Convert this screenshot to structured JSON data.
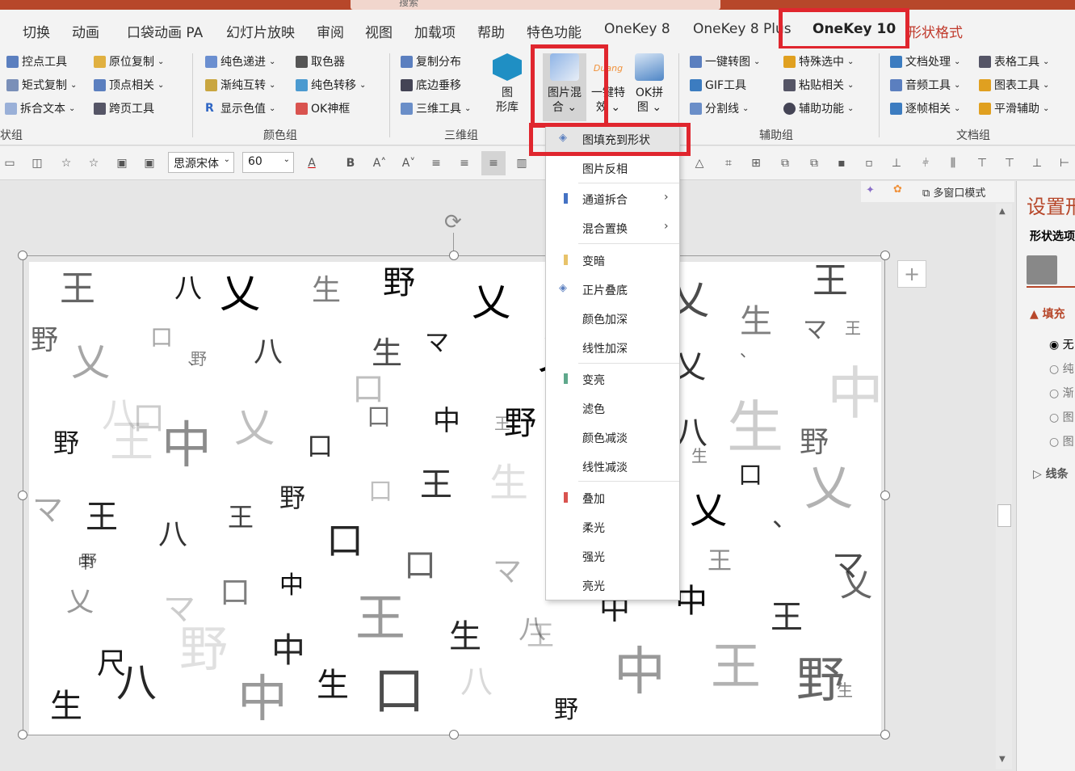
{
  "titlebar": {
    "search_text": "搜索"
  },
  "tabs": [
    "切换",
    "动画",
    "口袋动画 PA",
    "幻灯片放映",
    "审阅",
    "视图",
    "加载项",
    "帮助",
    "特色功能",
    "OneKey 8",
    "OneKey 8 Plus",
    "OneKey 10",
    "形状格式"
  ],
  "ribbon": {
    "group1": {
      "items": [
        "控点工具",
        "原位复制",
        "矩式复制",
        "顶点相关",
        "拆合文本",
        "跨页工具"
      ],
      "label": "状组"
    },
    "group2": {
      "items": [
        "纯色递进",
        "取色器",
        "渐纯互转",
        "纯色转移",
        "显示色值",
        "OK神框"
      ],
      "label": "颜色组"
    },
    "group3": {
      "items": [
        "复制分布",
        "底边垂移",
        "三维工具"
      ],
      "big": [
        "图",
        "形库"
      ],
      "label": "三维组"
    },
    "blend": {
      "label1": "图片混",
      "label2": "合",
      "effect1": "一键特",
      "effect2": "效",
      "okjoin1": "OK拼",
      "okjoin2": "图",
      "logo_text": "Duang"
    },
    "group4": {
      "items": [
        "一键转图",
        "特殊选中",
        "GIF工具",
        "粘贴相关",
        "分割线",
        "辅助功能"
      ],
      "label": "辅助组"
    },
    "group5": {
      "items": [
        "文档处理",
        "表格工具",
        "音频工具",
        "图表工具",
        "逐帧相关",
        "平滑辅助"
      ],
      "label": "文档组"
    }
  },
  "format": {
    "font": "思源宋体",
    "size": "60"
  },
  "subbar": {
    "multiwindow": "多窗口模式"
  },
  "rightpanel": {
    "title": "设置形",
    "section": "形状选项",
    "fill": "填充",
    "options": [
      "无",
      "纯",
      "渐",
      "图",
      "图"
    ],
    "line": "线条"
  },
  "menu": {
    "items": [
      {
        "label": "图填充到形状",
        "color": ""
      },
      {
        "label": "图片反相",
        "color": ""
      },
      {
        "label": "通道拆合",
        "color": "#4472c4",
        "arrow": true
      },
      {
        "label": "混合置换",
        "color": "",
        "arrow": true
      },
      {
        "label": "变暗",
        "color": "#e8c36a"
      },
      {
        "label": "正片叠底",
        "color": ""
      },
      {
        "label": "颜色加深",
        "color": ""
      },
      {
        "label": "线性加深",
        "color": ""
      },
      {
        "label": "变亮",
        "color": "#5fa88c"
      },
      {
        "label": "滤色",
        "color": ""
      },
      {
        "label": "颜色减淡",
        "color": ""
      },
      {
        "label": "线性减淡",
        "color": ""
      },
      {
        "label": "叠加",
        "color": "#d9534f"
      },
      {
        "label": "柔光",
        "color": ""
      },
      {
        "label": "强光",
        "color": ""
      },
      {
        "label": "亮光",
        "color": ""
      }
    ]
  },
  "slide_glyphs": [
    "王",
    "八",
    "乂",
    "生",
    "野",
    "乂",
    "乂",
    "王",
    "野",
    "乂",
    "口",
    "、",
    "八",
    "生",
    "マ",
    "乂",
    "乂",
    "生",
    "マ",
    "、",
    "王",
    "口",
    "中",
    "八",
    "口",
    "中",
    "乂",
    "口",
    "中",
    "野",
    "八",
    "生",
    "野",
    "野",
    "口",
    "王",
    "マ",
    "王",
    "八",
    "王",
    "野",
    "口",
    "王",
    "生",
    "口",
    "乂",
    "乂",
    "口",
    "、",
    "中",
    "口",
    "マ",
    "口",
    "中",
    "マ",
    "王",
    "マ",
    "乂",
    "王",
    "生",
    "王",
    "中",
    "中",
    "王",
    "野",
    "中",
    "生",
    "口",
    "八",
    "中",
    "王",
    "野",
    "生",
    "八",
    "中",
    "野",
    "尺",
    "八",
    "乂",
    "王",
    "生",
    "生",
    "野",
    "野",
    "、",
    "、",
    "、",
    "、"
  ],
  "colors": {
    "accent": "#b7472a",
    "highlight": "#e0262e"
  }
}
